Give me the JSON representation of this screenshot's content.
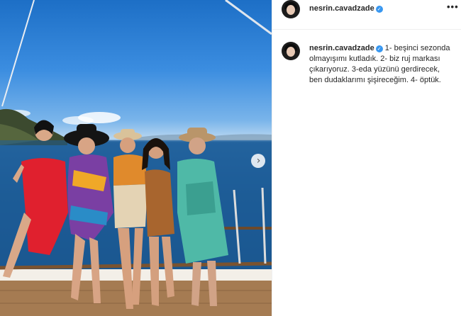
{
  "post": {
    "username": "nesrin.cavadzade",
    "verified_icon": "verified-badge-icon",
    "more_icon": "more-options-icon",
    "more_label": "•••",
    "caption": "1- beşinci sezonda olmayışımı kutladık. 2- biz ruj markası çıkarıyoruz. 3-eda yüzünü gerdirecek, ben dudaklarımı şişireceğim. 4- öptük.",
    "next_label": "›"
  },
  "colors": {
    "verified": "#3897f0",
    "text": "#262626",
    "divider": "#efefef",
    "sky": "#3b8de0",
    "sea": "#1d5b96"
  }
}
